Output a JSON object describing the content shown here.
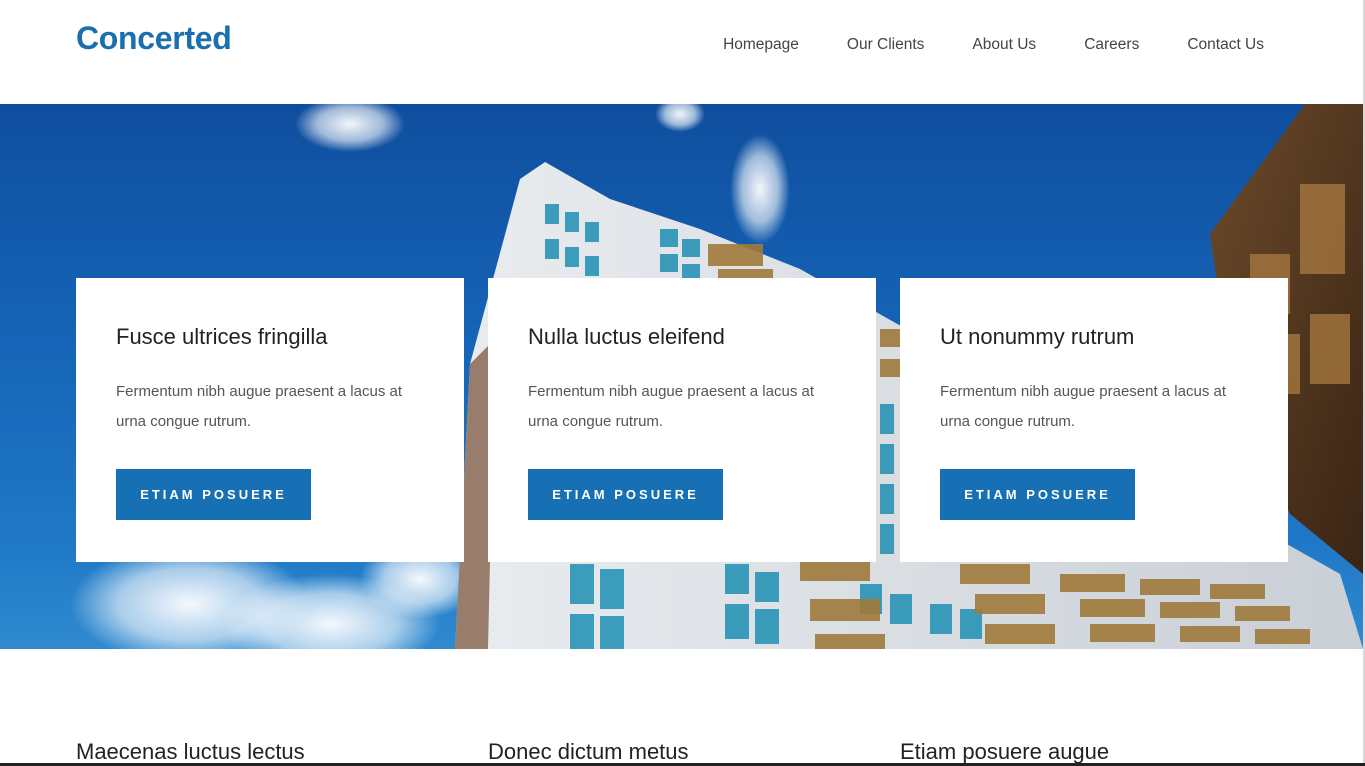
{
  "site": {
    "logo": "Concerted",
    "brand_color": "#1a6fae"
  },
  "nav": {
    "items": [
      {
        "label": "Homepage"
      },
      {
        "label": "Our Clients"
      },
      {
        "label": "About Us"
      },
      {
        "label": "Careers"
      },
      {
        "label": "Contact Us"
      }
    ]
  },
  "hero": {
    "image_icon": "building-photo-icon",
    "cards": [
      {
        "title": "Fusce ultrices fringilla",
        "text": "Fermentum nibh augue praesent a lacus at urna congue rutrum.",
        "button": "ETIAM POSUERE"
      },
      {
        "title": "Nulla luctus eleifend",
        "text": "Fermentum nibh augue praesent a lacus at urna congue rutrum.",
        "button": "ETIAM POSUERE"
      },
      {
        "title": "Ut nonummy rutrum",
        "text": "Fermentum nibh augue praesent a lacus at urna congue rutrum.",
        "button": "ETIAM POSUERE"
      }
    ],
    "button_color": "#1770b4"
  },
  "features": {
    "headings": [
      "Maecenas luctus lectus",
      "Donec dictum metus",
      "Etiam posuere augue"
    ]
  }
}
